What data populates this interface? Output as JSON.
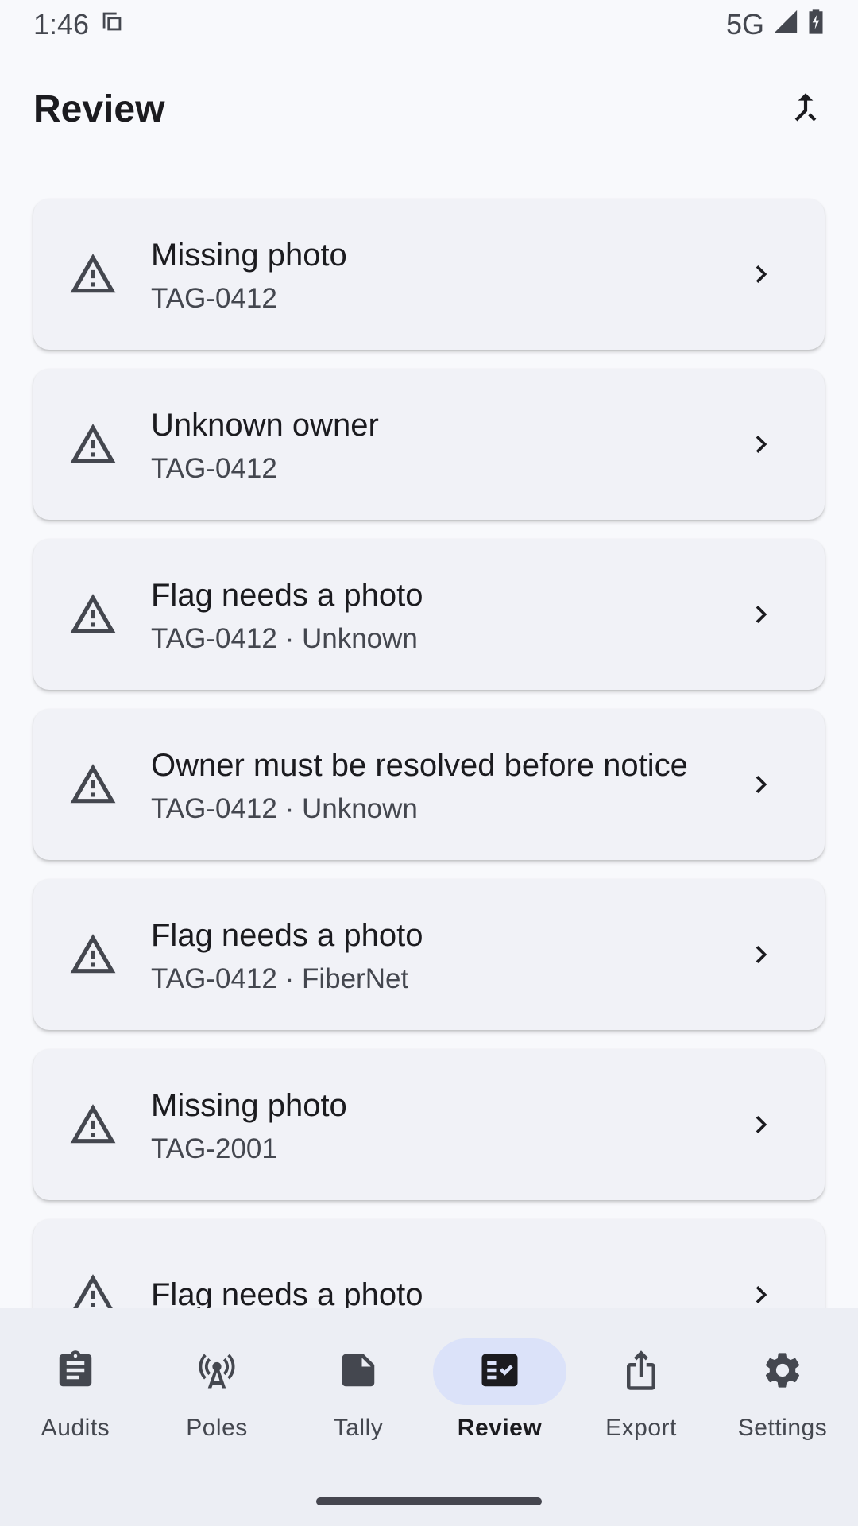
{
  "status_bar": {
    "time": "1:46",
    "network": "5G"
  },
  "app_bar": {
    "title": "Review"
  },
  "review_items": [
    {
      "title": "Missing photo",
      "subtitle": "TAG-0412"
    },
    {
      "title": "Unknown owner",
      "subtitle": "TAG-0412"
    },
    {
      "title": "Flag needs a photo",
      "subtitle": "TAG-0412 · Unknown"
    },
    {
      "title": "Owner must be resolved before notice",
      "subtitle": "TAG-0412 · Unknown"
    },
    {
      "title": "Flag needs a photo",
      "subtitle": "TAG-0412 · FiberNet"
    },
    {
      "title": "Missing photo",
      "subtitle": "TAG-2001"
    },
    {
      "title": "Flag needs a photo",
      "subtitle": ""
    }
  ],
  "bottom_nav": {
    "items": [
      {
        "label": "Audits",
        "icon": "clipboard-icon"
      },
      {
        "label": "Poles",
        "icon": "antenna-icon"
      },
      {
        "label": "Tally",
        "icon": "note-icon"
      },
      {
        "label": "Review",
        "icon": "fact-check-icon",
        "active": true
      },
      {
        "label": "Export",
        "icon": "share-icon"
      },
      {
        "label": "Settings",
        "icon": "gear-icon"
      }
    ]
  },
  "colors": {
    "background": "#f8f9fc",
    "card": "#f1f2f7",
    "nav_background": "#eceef4",
    "active_indicator": "#dbe2f9",
    "text_primary": "#1b1b1f",
    "text_secondary": "#44474f"
  }
}
